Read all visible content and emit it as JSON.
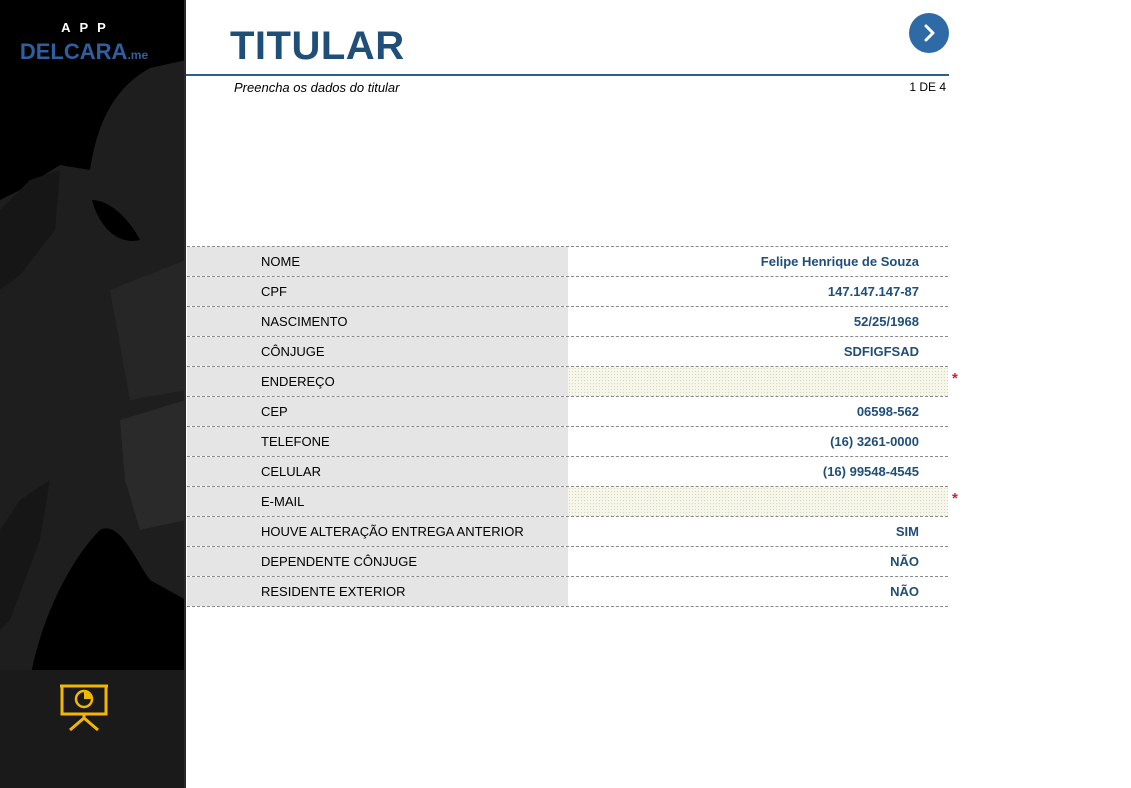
{
  "sidebar": {
    "brand_top": "APP",
    "brand_name": "DELCARA",
    "brand_suffix": ".me",
    "footer_icon": "presentation-chart-icon",
    "colors": {
      "background": "#000000",
      "silhouette": "#1e1e1e",
      "brand": "#2f5fa0",
      "icon": "#f2b705"
    }
  },
  "header": {
    "title": "TITULAR",
    "subtitle": "Preencha os dados do titular",
    "page_counter": "1 DE 4",
    "next_icon": "chevron-right-icon",
    "colors": {
      "title": "#1f4e79",
      "next_button": "#2e6aa6"
    }
  },
  "form": {
    "rows": [
      {
        "label": "NOME",
        "value": "Felipe Henrique de Souza",
        "required_missing": false
      },
      {
        "label": "CPF",
        "value": "147.147.147-87",
        "required_missing": false
      },
      {
        "label": "NASCIMENTO",
        "value": "52/25/1968",
        "required_missing": false
      },
      {
        "label": "CÔNJUGE",
        "value": "SDFIGFSAD",
        "required_missing": false
      },
      {
        "label": "ENDEREÇO",
        "value": "",
        "required_missing": true,
        "marker": "*"
      },
      {
        "label": "CEP",
        "value": "06598-562",
        "required_missing": false
      },
      {
        "label": "TELEFONE",
        "value": "(16) 3261-0000",
        "required_missing": false
      },
      {
        "label": "CELULAR",
        "value": "(16) 99548-4545",
        "required_missing": false
      },
      {
        "label": "E-MAIL",
        "value": "",
        "required_missing": true,
        "marker": "*"
      },
      {
        "label": "HOUVE ALTERAÇÃO ENTREGA ANTERIOR",
        "value": "SIM",
        "required_missing": false
      },
      {
        "label": "DEPENDENTE CÔNJUGE",
        "value": "NÃO",
        "required_missing": false
      },
      {
        "label": "RESIDENTE EXTERIOR",
        "value": "NÃO",
        "required_missing": false
      }
    ],
    "colors": {
      "label_bg": "#e6e5e5",
      "value_text": "#1f4e79",
      "required_marker": "#d0222a"
    }
  }
}
